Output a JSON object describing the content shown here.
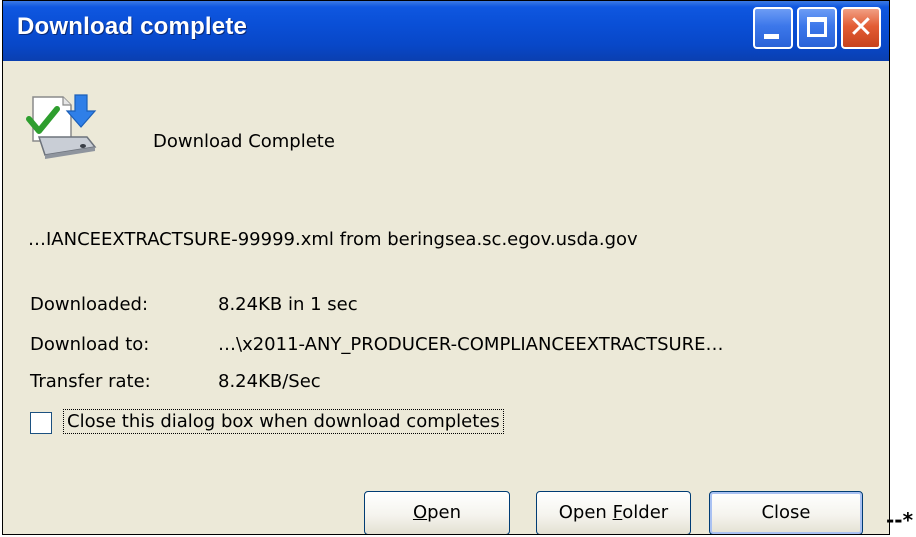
{
  "window": {
    "title": "Download complete",
    "controls": {
      "minimize_icon": "minimize-icon",
      "maximize_icon": "maximize-icon",
      "close_icon": "close-icon",
      "close_glyph": "✕"
    }
  },
  "dialog": {
    "heading": "Download Complete",
    "file_line": "…IANCEEXTRACTSURE-99999.xml from beringsea.sc.egov.usda.gov",
    "info": [
      {
        "label": "Downloaded:",
        "value": "8.24KB in 1 sec"
      },
      {
        "label": "Download to:",
        "value": "…\\x2011-ANY_PRODUCER-COMPLIANCEEXTRACTSURE…"
      },
      {
        "label": "Transfer rate:",
        "value": "8.24KB/Sec"
      }
    ],
    "checkbox": {
      "label": "Close this dialog box when download completes",
      "checked": false
    }
  },
  "buttons": {
    "open": {
      "mnemonic": "O",
      "rest": "pen"
    },
    "open_folder": {
      "before": "Open ",
      "mnemonic": "F",
      "rest": "older"
    },
    "close": "Close"
  },
  "trailing_text": "--*",
  "colors": {
    "titlebar": "#0a4fd6",
    "dialog_bg": "#ece9d8",
    "close_button": "#e35d35",
    "button_border": "#003c74"
  }
}
